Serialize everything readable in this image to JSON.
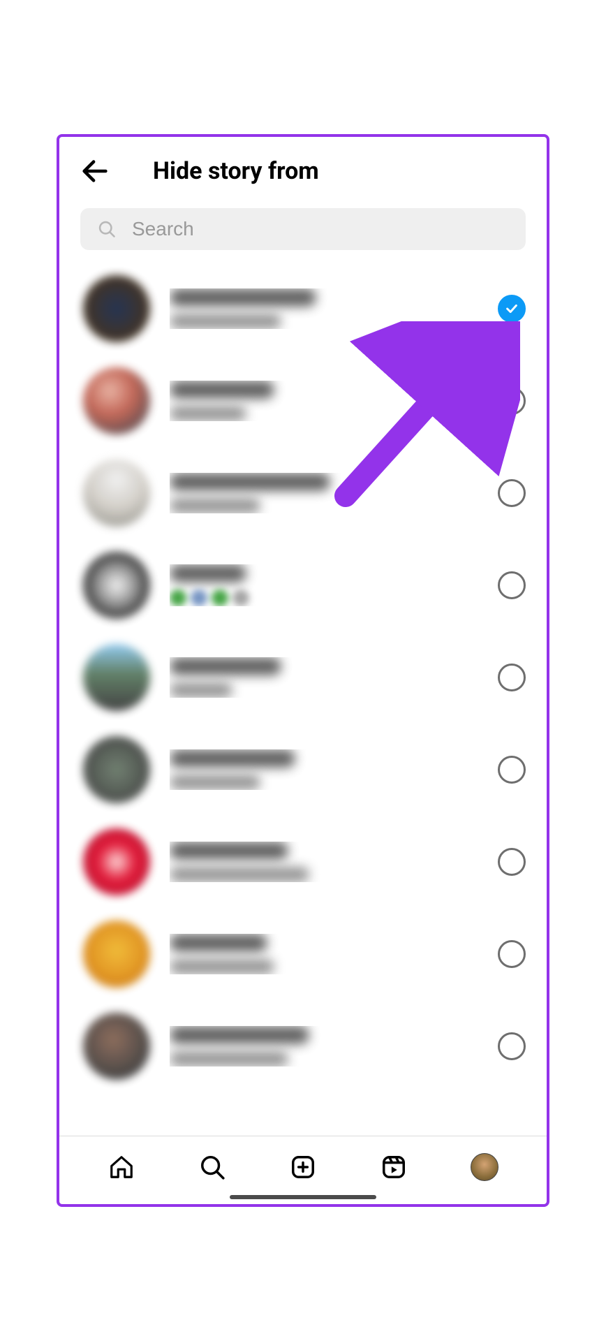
{
  "header": {
    "title": "Hide story from"
  },
  "search": {
    "placeholder": "Search"
  },
  "users": [
    {
      "checked": true,
      "avatarGradient": "radial-gradient(circle, #1a2a4a 0%, #3a2a1a 70%)",
      "unameWidth": 210,
      "subWidth": 160
    },
    {
      "checked": false,
      "avatarGradient": "radial-gradient(circle at 40% 35%, #e8b0a0 0%, #c06050 40%, #404048 90%)",
      "unameWidth": 150,
      "subWidth": 110,
      "emojiRow": false
    },
    {
      "checked": false,
      "avatarGradient": "radial-gradient(circle at 50% 30%, #f0f0f0 0%, #d0ccc5 50%, #808078 100%)",
      "unameWidth": 230,
      "subWidth": 130
    },
    {
      "checked": false,
      "avatarGradient": "radial-gradient(circle at 50% 50%, #f0f0f0 0%, #aaa 30%, #222 75%)",
      "unameWidth": 110,
      "subWidth": 150,
      "emojiRow": true
    },
    {
      "checked": false,
      "avatarGradient": "linear-gradient(180deg, #8cc8f0 0%, #5a7a60 45%, #3a3a3a 100%)",
      "unameWidth": 160,
      "subWidth": 90
    },
    {
      "checked": false,
      "avatarGradient": "radial-gradient(circle, #6a7a6a 0%, #383838 90%)",
      "unameWidth": 180,
      "subWidth": 130
    },
    {
      "checked": false,
      "avatarGradient": "radial-gradient(circle at 50% 50%, #ffd8d8 0%, #e01030 40%, #b00828 90%)",
      "unameWidth": 170,
      "subWidth": 200
    },
    {
      "checked": false,
      "avatarGradient": "radial-gradient(circle at 50% 45%, #f0b830 0%, #e09018 55%, #b86810 100%)",
      "unameWidth": 140,
      "subWidth": 150
    },
    {
      "checked": false,
      "avatarGradient": "radial-gradient(circle at 45% 40%, #886655 0%, #3a3a3a 75%)",
      "unameWidth": 200,
      "subWidth": 170
    }
  ],
  "annotation": {
    "arrowColor": "#9333ea"
  }
}
